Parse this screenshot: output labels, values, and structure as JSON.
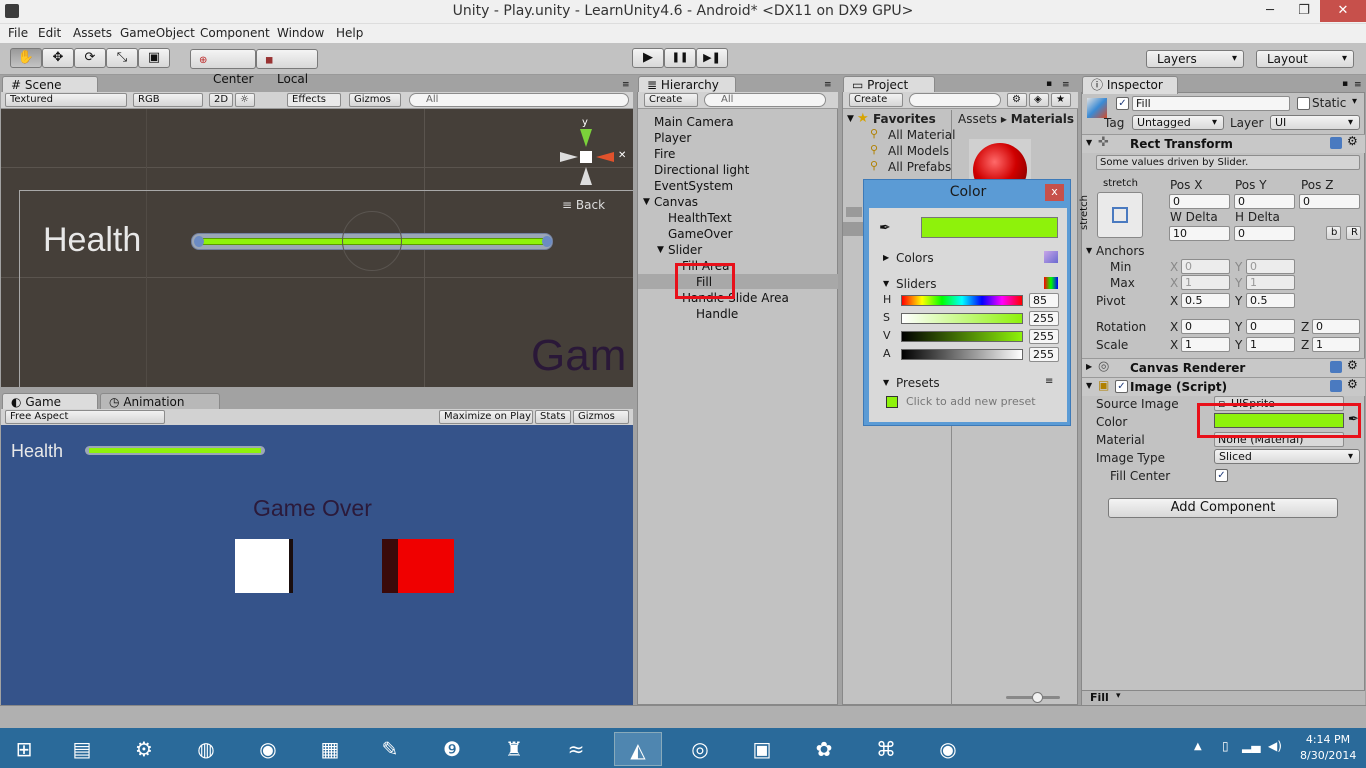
{
  "window": {
    "title": "Unity - Play.unity - LearnUnity4.6 - Android* <DX11 on DX9 GPU>",
    "minimize": "─",
    "maximize": "❐",
    "close": "✕"
  },
  "menu": [
    "File",
    "Edit",
    "Assets",
    "GameObject",
    "Component",
    "Window",
    "Help"
  ],
  "toolbar": {
    "tools": [
      "hand-icon",
      "move-icon",
      "rotate-icon",
      "scale-icon",
      "rect-icon"
    ],
    "tool_glyphs": [
      "✋",
      "✥",
      "⟳",
      "⤡",
      "▣"
    ],
    "pivot": "Center",
    "space": "Local",
    "play": "▶",
    "pause": "❚❚",
    "step": "▶❚",
    "layers": "Layers",
    "layout": "Layout"
  },
  "scene": {
    "tab": "Scene",
    "shading": "Textured",
    "render": "RGB",
    "mode2d": "2D",
    "sun": "☼",
    "effects": "Effects",
    "gizmos": "Gizmos",
    "search_placeholder": "All",
    "axis_y": "y",
    "back": "Back",
    "health": "Health",
    "gameover_partial": "Gam"
  },
  "game": {
    "tab": "Game",
    "animation_tab": "Animation",
    "aspect": "Free Aspect",
    "maximize": "Maximize on Play",
    "stats": "Stats",
    "gizmos": "Gizmos",
    "health": "Health",
    "gameover": "Game Over"
  },
  "hierarchy": {
    "tab": "Hierarchy",
    "create": "Create",
    "search_placeholder": "All",
    "items": [
      "Main Camera",
      "Player",
      "Fire",
      "Directional light",
      "EventSystem",
      "Canvas",
      "HealthText",
      "GameOver",
      "Slider",
      "Fill Area",
      "Fill",
      "Handle Slide Area",
      "Handle"
    ]
  },
  "project": {
    "tab": "Project",
    "create": "Create",
    "favorites": "Favorites",
    "fav_items": [
      "All Material",
      "All Models",
      "All Prefabs"
    ],
    "crumb_root": "Assets",
    "crumb_sep": "▸",
    "crumb_leaf": "Materials"
  },
  "color_picker": {
    "title": "Color",
    "close": "x",
    "colors": "Colors",
    "sliders": "Sliders",
    "channels": [
      {
        "name": "H",
        "value": "85"
      },
      {
        "name": "S",
        "value": "255"
      },
      {
        "name": "V",
        "value": "255"
      },
      {
        "name": "A",
        "value": "255"
      }
    ],
    "presets": "Presets",
    "add_preset": "Click to add new preset",
    "swatch_color": "#8ef20b"
  },
  "inspector": {
    "tab": "Inspector",
    "name": "Fill",
    "static": "Static",
    "tag_label": "Tag",
    "tag": "Untagged",
    "layer_label": "Layer",
    "layer": "UI",
    "rect_transform": "Rect Transform",
    "driven_note": "Some values driven by Slider.",
    "stretch": "stretch",
    "stretch_side": "stretch",
    "pos_x_label": "Pos X",
    "pos_y_label": "Pos Y",
    "pos_z_label": "Pos Z",
    "pos_x": "0",
    "pos_y": "0",
    "pos_z": "0",
    "w_delta_label": "W Delta",
    "h_delta_label": "H Delta",
    "w_delta": "10",
    "h_delta": "0",
    "btn_b": "b",
    "btn_r": "R",
    "anchors": "Anchors",
    "min": "Min",
    "max": "Max",
    "min_x": "0",
    "min_y": "0",
    "max_x": "1",
    "max_y": "1",
    "pivot": "Pivot",
    "pivot_x": "0.5",
    "pivot_y": "0.5",
    "rotation": "Rotation",
    "rot_x": "0",
    "rot_y": "0",
    "rot_z": "0",
    "scale": "Scale",
    "scale_x": "1",
    "scale_y": "1",
    "scale_z": "1",
    "x": "X",
    "y": "Y",
    "z": "Z",
    "canvas_renderer": "Canvas Renderer",
    "image_script": "Image (Script)",
    "source_image_label": "Source Image",
    "source_image": "UISprite",
    "color_label": "Color",
    "material_label": "Material",
    "material": "None (Material)",
    "image_type_label": "Image Type",
    "image_type": "Sliced",
    "fill_center_label": "Fill Center",
    "add_component": "Add Component",
    "footer": "Fill"
  },
  "taskbar": {
    "time": "4:14 PM",
    "date": "8/30/2014",
    "apps": [
      "windows-icon",
      "file-explorer-icon",
      "control-panel-icon",
      "globe-icon",
      "firefox-icon",
      "office-icon",
      "notepad-icon",
      "media-icon",
      "game-icon",
      "visual-studio-icon",
      "unity-icon",
      "chrome-icon",
      "sg-icon",
      "paint-icon",
      "network-icon",
      "firefox-icon-2"
    ],
    "app_glyphs": [
      "⊞",
      "▤",
      "⚙",
      "◍",
      "◉",
      "▦",
      "✎",
      "❾",
      "♜",
      "≈",
      "◭",
      "◎",
      "▣",
      "✿",
      "⌘",
      "◉"
    ]
  },
  "colors": {
    "fill_green": "#8ef20b",
    "highlight_red": "#e8101a"
  }
}
